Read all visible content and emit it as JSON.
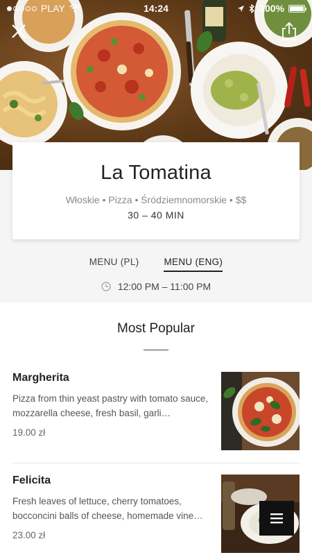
{
  "status_bar": {
    "carrier": "PLAY",
    "time": "14:24",
    "battery": "100%",
    "battery_level": 1.0
  },
  "restaurant": {
    "name": "La Tomatina",
    "categories": "Włoskie • Pizza • Śródziemnomorskie • $$",
    "delivery_time": "30 – 40 MIN"
  },
  "tabs": [
    {
      "label": "MENU (PL)",
      "active": false
    },
    {
      "label": "MENU (ENG)",
      "active": true
    }
  ],
  "hours": "12:00 PM – 11:00 PM",
  "section": {
    "title": "Most Popular"
  },
  "items": [
    {
      "title": "Margherita",
      "description": "Pizza from thin yeast pastry with tomato sauce, mozzarella cheese, fresh basil, garli…",
      "price": "19.00 zł"
    },
    {
      "title": "Felicita",
      "description": "Fresh leaves of lettuce, cherry tomatoes, bocconcini balls of cheese, homemade vine…",
      "price": "23.00 zł"
    }
  ],
  "colors": {
    "accent": "#111111",
    "background": "#f5f5f5",
    "card": "#ffffff"
  },
  "icons": [
    "close-icon",
    "share-icon",
    "clock-icon",
    "menu-icon",
    "wifi-icon",
    "location-arrow-icon",
    "bluetooth-icon",
    "battery-icon"
  ]
}
